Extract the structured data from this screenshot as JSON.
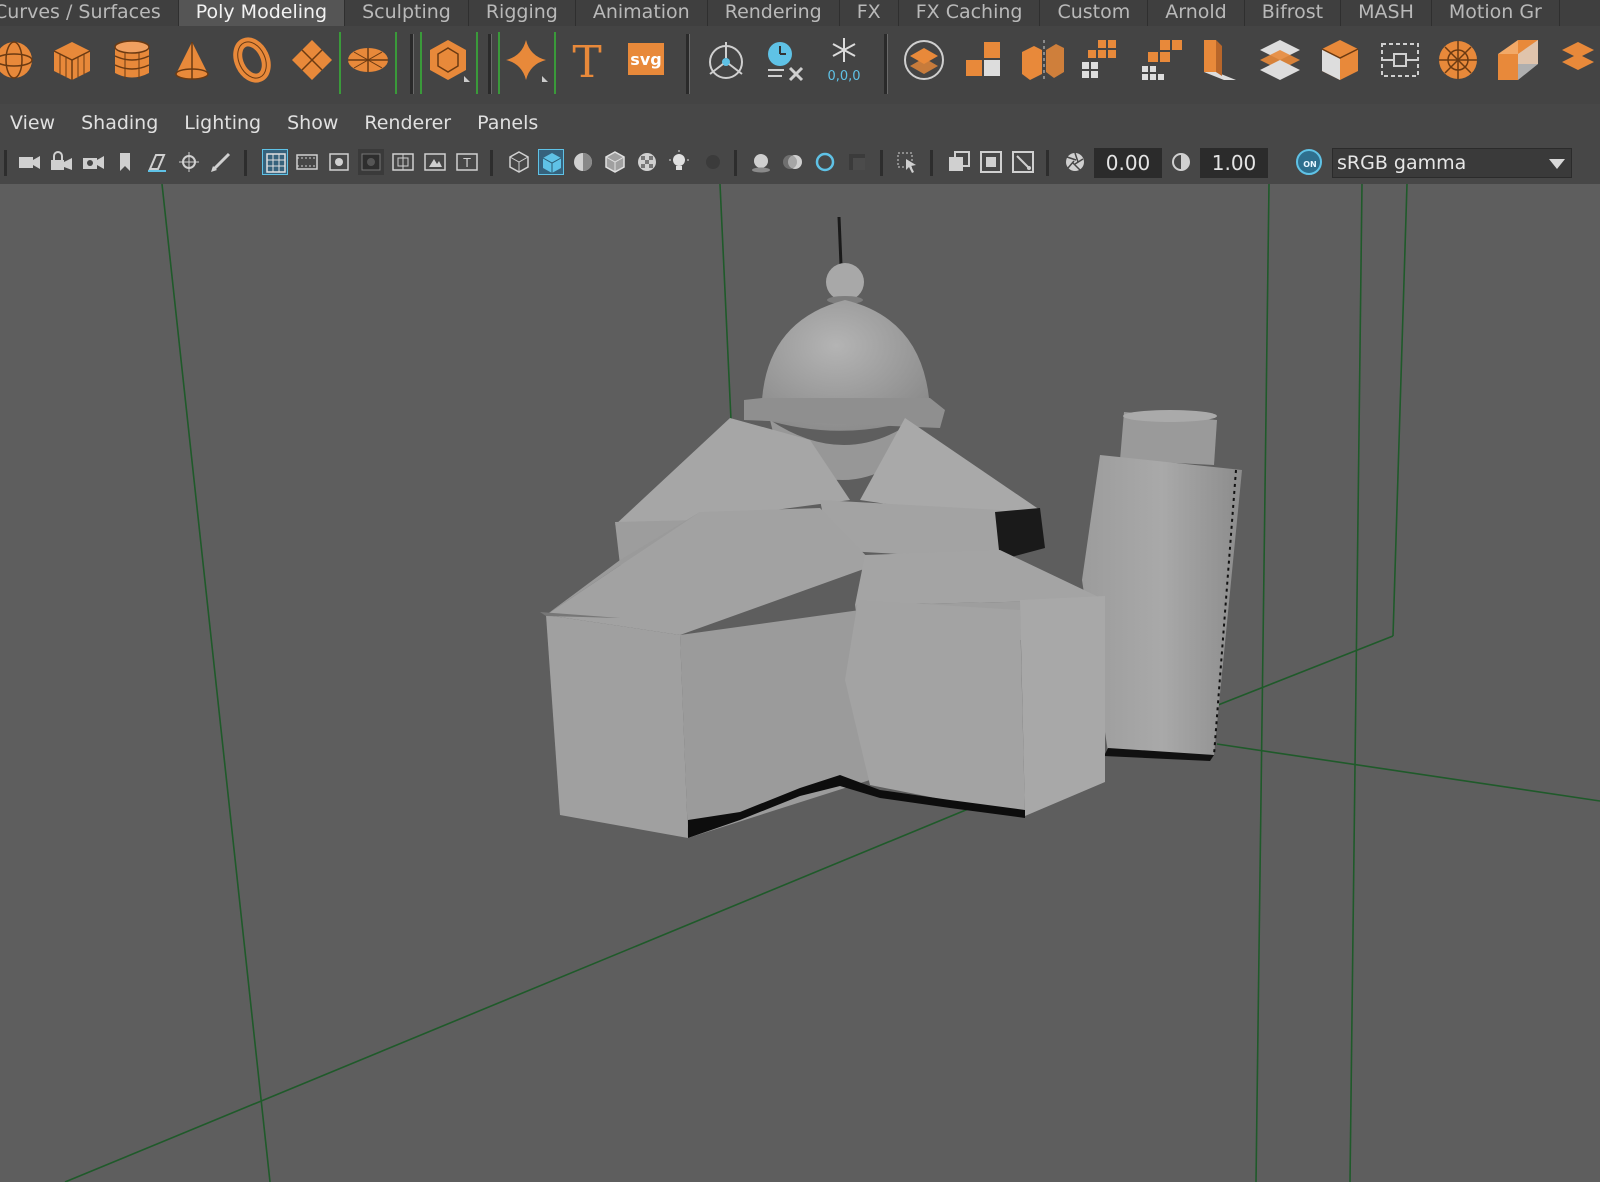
{
  "shelf_tabs": [
    "Curves / Surfaces",
    "Poly Modeling",
    "Sculpting",
    "Rigging",
    "Animation",
    "Rendering",
    "FX",
    "FX Caching",
    "Custom",
    "Arnold",
    "Bifrost",
    "MASH",
    "Motion Gr"
  ],
  "active_shelf_tab": "Poly Modeling",
  "shelf_icons": [
    "poly-sphere-icon",
    "poly-cube-icon",
    "poly-cylinder-icon",
    "poly-cone-icon",
    "poly-torus-icon",
    "poly-plane-icon",
    "poly-disc-icon",
    "platonic-solid-icon",
    "super-shape-icon",
    "type-text-icon",
    "svg-icon",
    "center-pivot-icon",
    "delete-history-icon",
    "freeze-transform-icon",
    "combine-icon",
    "separate-icon",
    "extract-icon",
    "smooth-icon",
    "bevel-icon",
    "bridge-icon",
    "extrude-icon",
    "multi-cut-icon",
    "target-weld-icon",
    "boolean-icon",
    "insert-loop-icon",
    "offset-loop-icon"
  ],
  "svg_label": "svg",
  "type_label": "T",
  "freeze_label": "0,0,0",
  "panel_menu": [
    "View",
    "Shading",
    "Lighting",
    "Show",
    "Renderer",
    "Panels"
  ],
  "toolbar": {
    "exposure_value": "0.00",
    "gamma_value": "1.00",
    "color_mgmt_toggle": "ON",
    "color_space": "sRGB gamma"
  },
  "colors": {
    "accent_orange": "#e8893a",
    "accent_blue": "#5fc2e6",
    "grid_green": "#1f5a2a",
    "viewport_bg": "#5e5e5e"
  }
}
